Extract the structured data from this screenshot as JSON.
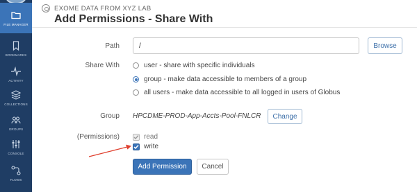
{
  "sidebar": {
    "items": [
      {
        "label": "FILE MANAGER",
        "icon": "folder-icon"
      },
      {
        "label": "BOOKMARKS",
        "icon": "bookmark-icon"
      },
      {
        "label": "ACTIVITY",
        "icon": "activity-icon"
      },
      {
        "label": "COLLECTIONS",
        "icon": "layers-icon"
      },
      {
        "label": "GROUPS",
        "icon": "groups-icon"
      },
      {
        "label": "CONSOLE",
        "icon": "sliders-icon"
      },
      {
        "label": "FLOWS",
        "icon": "flows-icon"
      }
    ],
    "active_index": 0
  },
  "header": {
    "eyebrow": "EXOME DATA FROM XYZ LAB",
    "title": "Add Permissions - Share With"
  },
  "form": {
    "path_label": "Path",
    "path_value": "/",
    "browse_label": "Browse",
    "share_with_label": "Share With",
    "share_options": [
      {
        "text": "user - share with specific individuals",
        "checked": false
      },
      {
        "text": "group - make data accessible to members of a group",
        "checked": true
      },
      {
        "text": "all users - make data accessible to all logged in users of Globus",
        "checked": false
      }
    ],
    "group_label": "Group",
    "group_value": "HPCDME-PROD-App-Accts-Pool-FNLCR",
    "change_label": "Change",
    "permissions_label": "(Permissions)",
    "permissions": [
      {
        "text": "read",
        "checked": true,
        "disabled": true
      },
      {
        "text": "write",
        "checked": true,
        "disabled": false
      }
    ],
    "add_permission_label": "Add Permission",
    "cancel_label": "Cancel"
  },
  "colors": {
    "sidebar_bg": "#1f3d64",
    "sidebar_active": "#3b74b8",
    "primary": "#3b74b8",
    "annotation_arrow": "#e0402f"
  }
}
